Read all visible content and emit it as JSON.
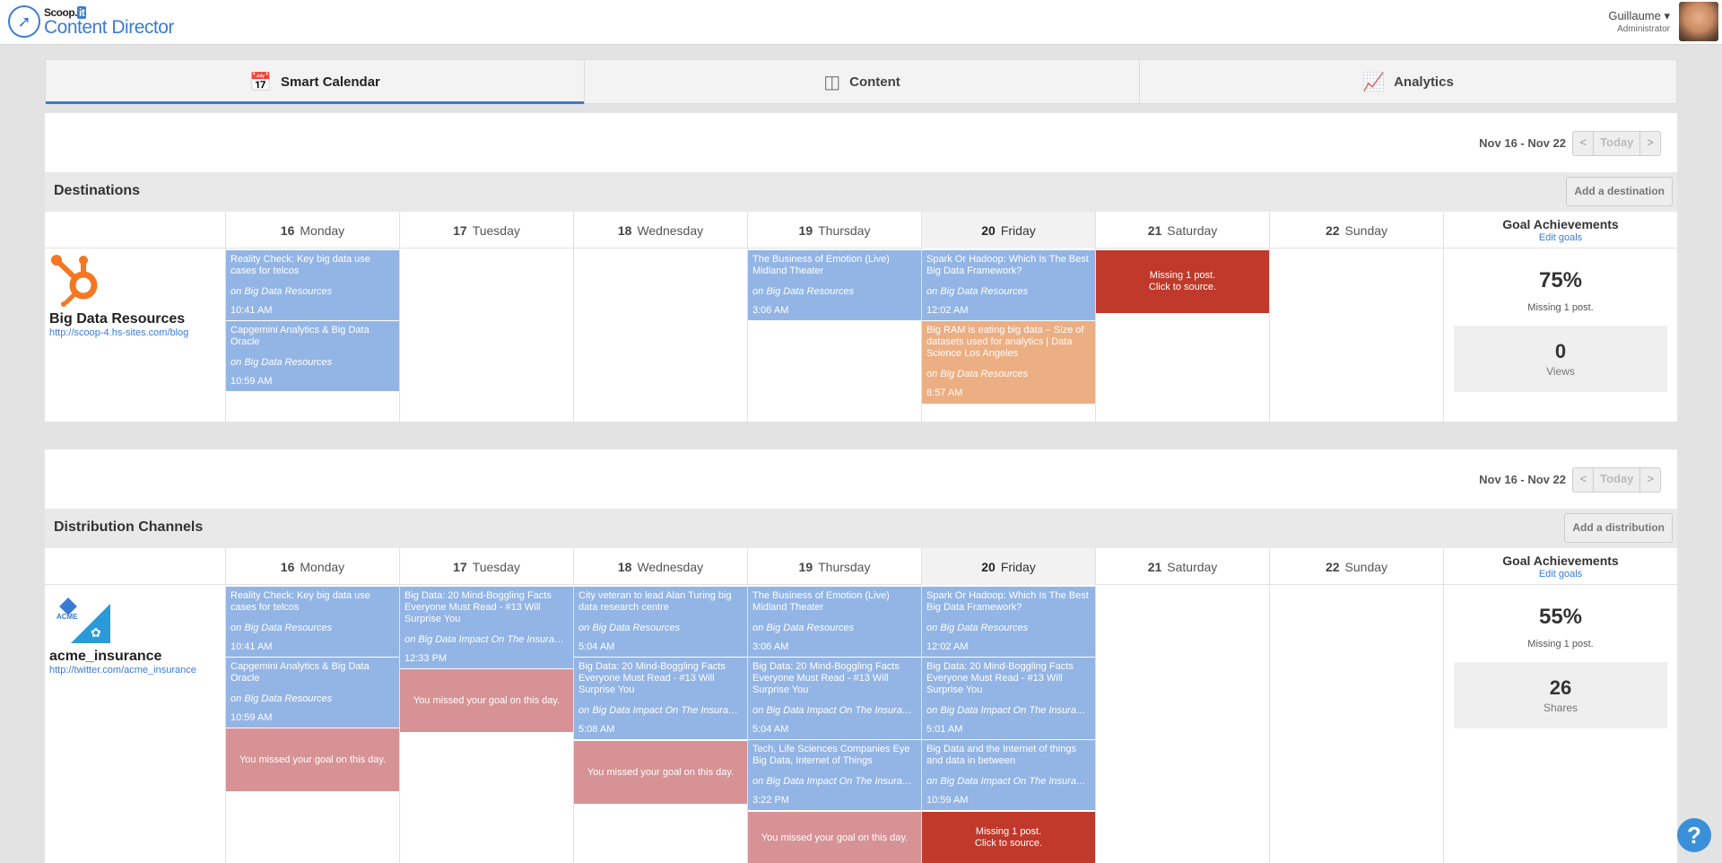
{
  "header": {
    "brand": "Scoop.",
    "brand_it": "it",
    "product": "Content Director",
    "user_name": "Guillaume ▾",
    "user_role": "Administrator"
  },
  "tabs": [
    {
      "label": "Smart Calendar",
      "icon": "calendar-icon"
    },
    {
      "label": "Content",
      "icon": "content-icon"
    },
    {
      "label": "Analytics",
      "icon": "analytics-icon"
    }
  ],
  "nav": {
    "range": "Nov 16 - Nov 22",
    "prev": "<",
    "today": "Today",
    "next": ">"
  },
  "days": [
    {
      "num": "16",
      "name": "Monday"
    },
    {
      "num": "17",
      "name": "Tuesday"
    },
    {
      "num": "18",
      "name": "Wednesday"
    },
    {
      "num": "19",
      "name": "Thursday"
    },
    {
      "num": "20",
      "name": "Friday"
    },
    {
      "num": "21",
      "name": "Saturday"
    },
    {
      "num": "22",
      "name": "Sunday"
    }
  ],
  "goal_header": {
    "title": "Goal Achievements",
    "edit": "Edit goals"
  },
  "destinations": {
    "title": "Destinations",
    "add_label": "Add a destination",
    "name": "Big Data Resources",
    "url": "http://scoop-4.hs-sites.com/blog",
    "goal": {
      "pct": "75%",
      "missing_pre": "Missing",
      "missing_n": "1",
      "missing_post": "post.",
      "stat": "0",
      "stat_label": "Views"
    },
    "cards": {
      "mon1": {
        "title": "Reality Check: Key big data use cases for telcos",
        "on": "on",
        "src": "Big Data Resources",
        "time": "10:41 AM"
      },
      "mon2": {
        "title": "Capgemini Analytics & Big Data Oracle",
        "on": "on",
        "src": "Big Data Resources",
        "time": "10:59 AM"
      },
      "thu1": {
        "title": "The Business of Emotion (Live) Midland Theater",
        "on": "on",
        "src": "Big Data Resources",
        "time": "3:06 AM"
      },
      "fri1": {
        "title": "Spark Or Hadoop: Which Is The Best Big Data Framework?",
        "on": "on",
        "src": "Big Data Resources",
        "time": "12:02 AM"
      },
      "fri2": {
        "title": "Big RAM is eating big data – Size of datasets used for analytics | Data Science Los Angeles",
        "on": "on",
        "src": "Big Data Resources",
        "time": "8:57 AM"
      },
      "sat_missing_1": "Missing 1 post.",
      "sat_missing_2": "Click to source."
    }
  },
  "channels": {
    "title": "Distribution Channels",
    "add_label": "Add a distribution",
    "name": "acme_insurance",
    "url": "http://twitter.com/acme_insurance",
    "logo_text": "ACME",
    "goal": {
      "pct": "55%",
      "missing_pre": "Missing",
      "missing_n": "1",
      "missing_post": "post.",
      "stat": "26",
      "stat_label": "Shares"
    },
    "missed": "You missed your goal on this day.",
    "cards": {
      "mon1": {
        "title": "Reality Check: Key big data use cases for telcos",
        "on": "on",
        "src": "Big Data Resources",
        "time": "10:41 AM"
      },
      "mon2": {
        "title": "Capgemini Analytics & Big Data Oracle",
        "on": "on",
        "src": "Big Data Resources",
        "time": "10:59 AM"
      },
      "tue1": {
        "title": "Big Data: 20 Mind-Boggling Facts Everyone Must Read - #13 Will Surprise You",
        "on": "on",
        "src": "Big Data Impact On The Insuranc...",
        "time": "12:33 PM"
      },
      "wed1": {
        "title": "City veteran to lead Alan Turing big data research centre",
        "on": "on",
        "src": "Big Data Resources",
        "time": "5:04 AM"
      },
      "wed2": {
        "title": "Big Data: 20 Mind-Boggling Facts Everyone Must Read - #13 Will Surprise You",
        "on": "on",
        "src": "Big Data Impact On The Insuranc...",
        "time": "5:08 AM"
      },
      "thu1": {
        "title": "The Business of Emotion (Live) Midland Theater",
        "on": "on",
        "src": "Big Data Resources",
        "time": "3:06 AM"
      },
      "thu2": {
        "title": "Big Data: 20 Mind-Boggling Facts Everyone Must Read - #13 Will Surprise You",
        "on": "on",
        "src": "Big Data Impact On The Insuranc...",
        "time": "5:04 AM"
      },
      "thu3": {
        "title": "Tech, Life Sciences Companies Eye Big Data, Internet of Things",
        "on": "on",
        "src": "Big Data Impact On The Insuranc...",
        "time": "3:22 PM"
      },
      "fri1": {
        "title": "Spark Or Hadoop: Which Is The Best Big Data Framework?",
        "on": "on",
        "src": "Big Data Resources",
        "time": "12:02 AM"
      },
      "fri2": {
        "title": "Big Data: 20 Mind-Boggling Facts Everyone Must Read - #13 Will Surprise You",
        "on": "on",
        "src": "Big Data Impact On The Insuranc...",
        "time": "5:01 AM"
      },
      "fri3": {
        "title": "Big Data and the Internet of things and data in between",
        "on": "on",
        "src": "Big Data Impact On The Insuranc...",
        "time": "10:59 AM"
      },
      "fri_missing_1": "Missing 1 post.",
      "fri_missing_2": "Click to source."
    }
  },
  "help": "?"
}
